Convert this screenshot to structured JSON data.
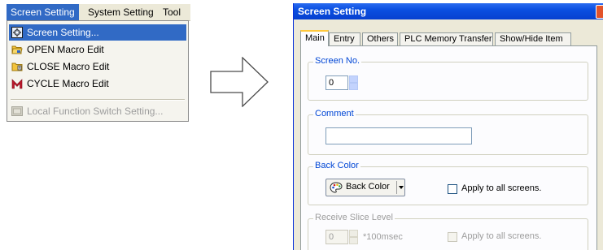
{
  "menubar": {
    "items": [
      {
        "label": "Screen Setting"
      },
      {
        "label": "System Setting"
      },
      {
        "label": "Tool"
      }
    ]
  },
  "dropdown": {
    "items": [
      {
        "label": "Screen Setting...",
        "icon": "screen-setting-icon"
      },
      {
        "label": "OPEN Macro Edit",
        "icon": "open-macro-icon"
      },
      {
        "label": "CLOSE Macro Edit",
        "icon": "close-macro-icon"
      },
      {
        "label": "CYCLE Macro Edit",
        "icon": "cycle-macro-icon"
      },
      {
        "label": "Local Function Switch Setting...",
        "icon": "local-function-icon"
      }
    ]
  },
  "dialog": {
    "title": "Screen Setting",
    "tabs": [
      {
        "label": "Main"
      },
      {
        "label": "Entry"
      },
      {
        "label": "Others"
      },
      {
        "label": "PLC Memory Transfer"
      },
      {
        "label": "Show/Hide Item"
      }
    ],
    "screen_no": {
      "legend": "Screen No.",
      "value": "0"
    },
    "comment": {
      "legend": "Comment",
      "value": ""
    },
    "back_color": {
      "legend": "Back Color",
      "button_label": "Back Color",
      "apply_label": "Apply to all screens."
    },
    "receive_slice": {
      "legend": "Receive Slice Level",
      "value": "0",
      "unit": "*100msec",
      "apply_label": "Apply to all screens."
    }
  },
  "colors": {
    "menu_highlight": "#316ac5",
    "titlebar": "#0a4fe0",
    "legend_text": "#0046d5",
    "active_tab_accent": "#ffc83c"
  }
}
